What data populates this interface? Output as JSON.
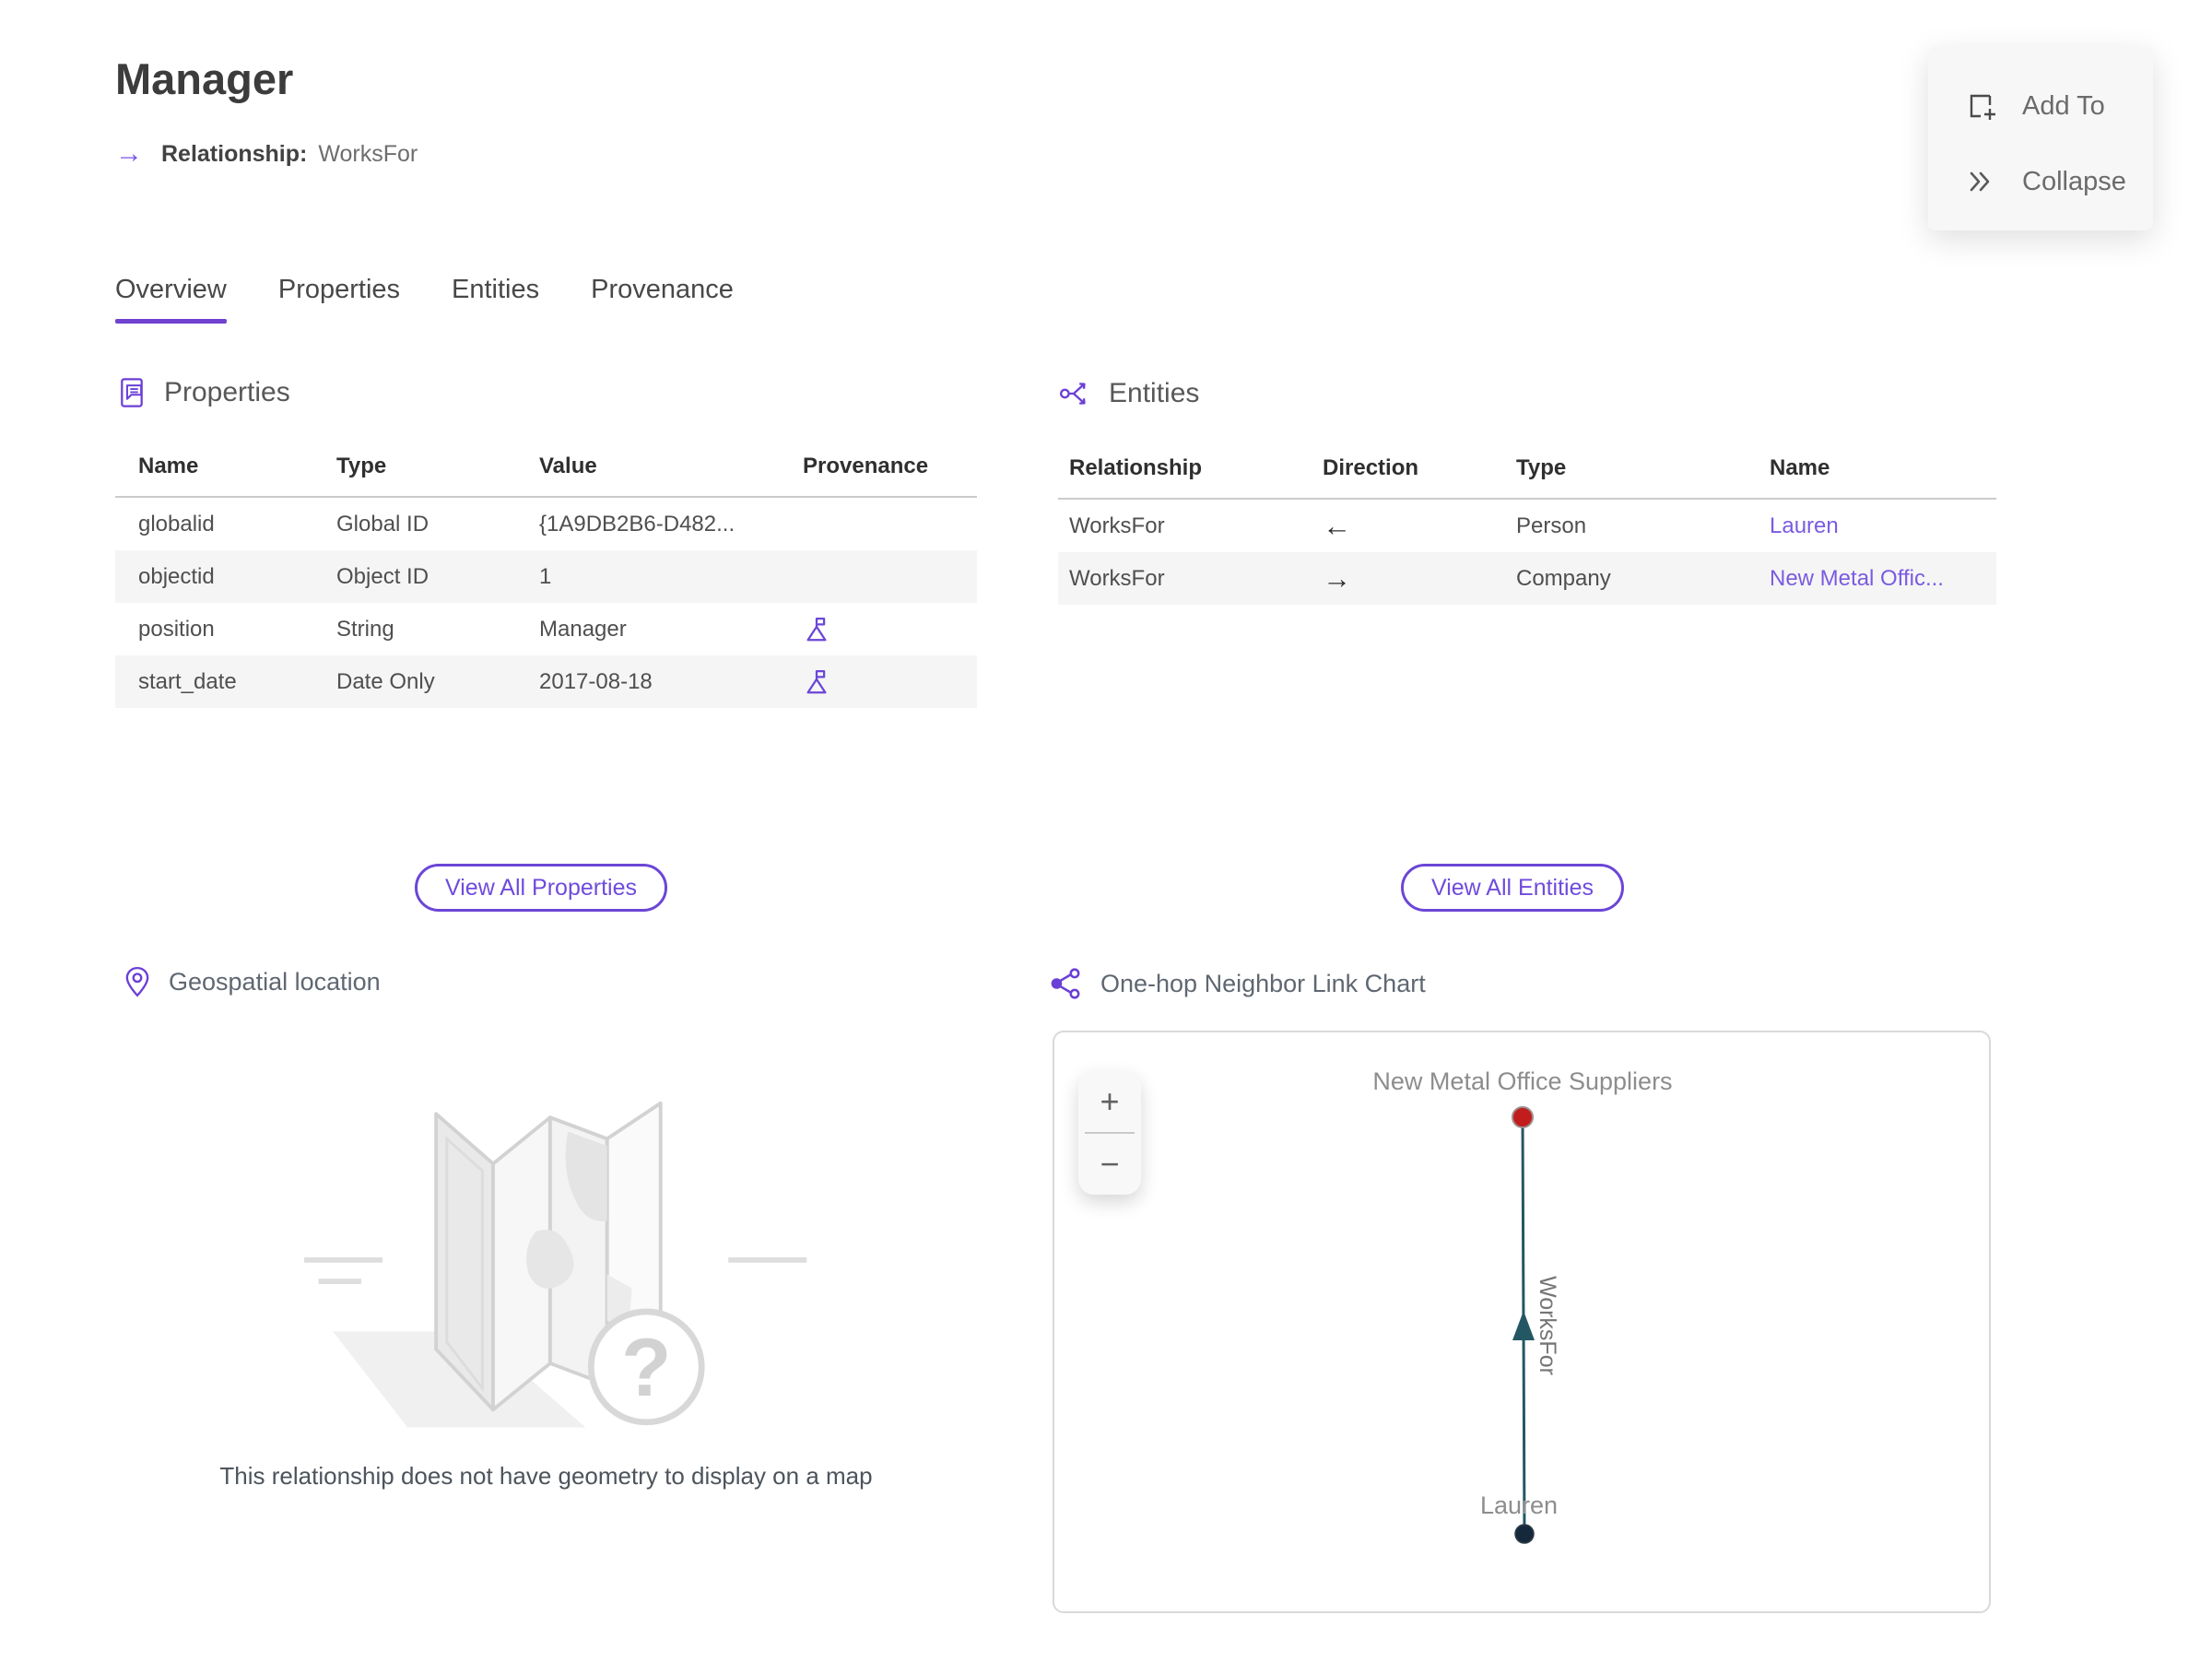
{
  "header": {
    "title": "Manager",
    "arrow_glyph": "→",
    "relationship_label": "Relationship:",
    "relationship_value": "WorksFor"
  },
  "actions_panel": {
    "add_to_label": "Add To",
    "collapse_label": "Collapse"
  },
  "tabs": [
    {
      "label": "Overview",
      "active": true
    },
    {
      "label": "Properties",
      "active": false
    },
    {
      "label": "Entities",
      "active": false
    },
    {
      "label": "Provenance",
      "active": false
    }
  ],
  "properties_section": {
    "title": "Properties",
    "columns": [
      "Name",
      "Type",
      "Value",
      "Provenance"
    ],
    "rows": [
      {
        "name": "globalid",
        "type": "Global ID",
        "value": "{1A9DB2B6-D482...",
        "provenance_flag": false
      },
      {
        "name": "objectid",
        "type": "Object ID",
        "value": "1",
        "provenance_flag": false
      },
      {
        "name": "position",
        "type": "String",
        "value": "Manager",
        "provenance_flag": true
      },
      {
        "name": "start_date",
        "type": "Date Only",
        "value": "2017-08-18",
        "provenance_flag": true
      }
    ],
    "view_all_label": "View All Properties"
  },
  "entities_section": {
    "title": "Entities",
    "columns": [
      "Relationship",
      "Direction",
      "Type",
      "Name"
    ],
    "rows": [
      {
        "relationship": "WorksFor",
        "direction": "←",
        "type": "Person",
        "name": "Lauren"
      },
      {
        "relationship": "WorksFor",
        "direction": "→",
        "type": "Company",
        "name": "New Metal Offic..."
      }
    ],
    "view_all_label": "View All Entities"
  },
  "geospatial_section": {
    "title": "Geospatial location",
    "empty_message": "This relationship does not have geometry to display on a map"
  },
  "link_chart_section": {
    "title": "One-hop Neighbor Link Chart",
    "zoom_in_label": "+",
    "zoom_out_label": "−",
    "chart_data": {
      "type": "node-link",
      "nodes": [
        {
          "label": "New Metal Office Suppliers",
          "color": "#c21d1d"
        },
        {
          "label": "Lauren",
          "color": "#16293b"
        }
      ],
      "edges": [
        {
          "label": "WorksFor",
          "source": "Lauren",
          "target": "New Metal Office Suppliers",
          "color": "#245764",
          "direction": "up"
        }
      ]
    }
  },
  "colors": {
    "accent_purple": "#6b46d6",
    "link_purple": "#7a5be0",
    "active_tab_underline": "#6f42cf",
    "row_stripe": "#f5f5f5",
    "node_red": "#c21d1d",
    "node_dark": "#16293b",
    "edge_teal": "#245764"
  }
}
